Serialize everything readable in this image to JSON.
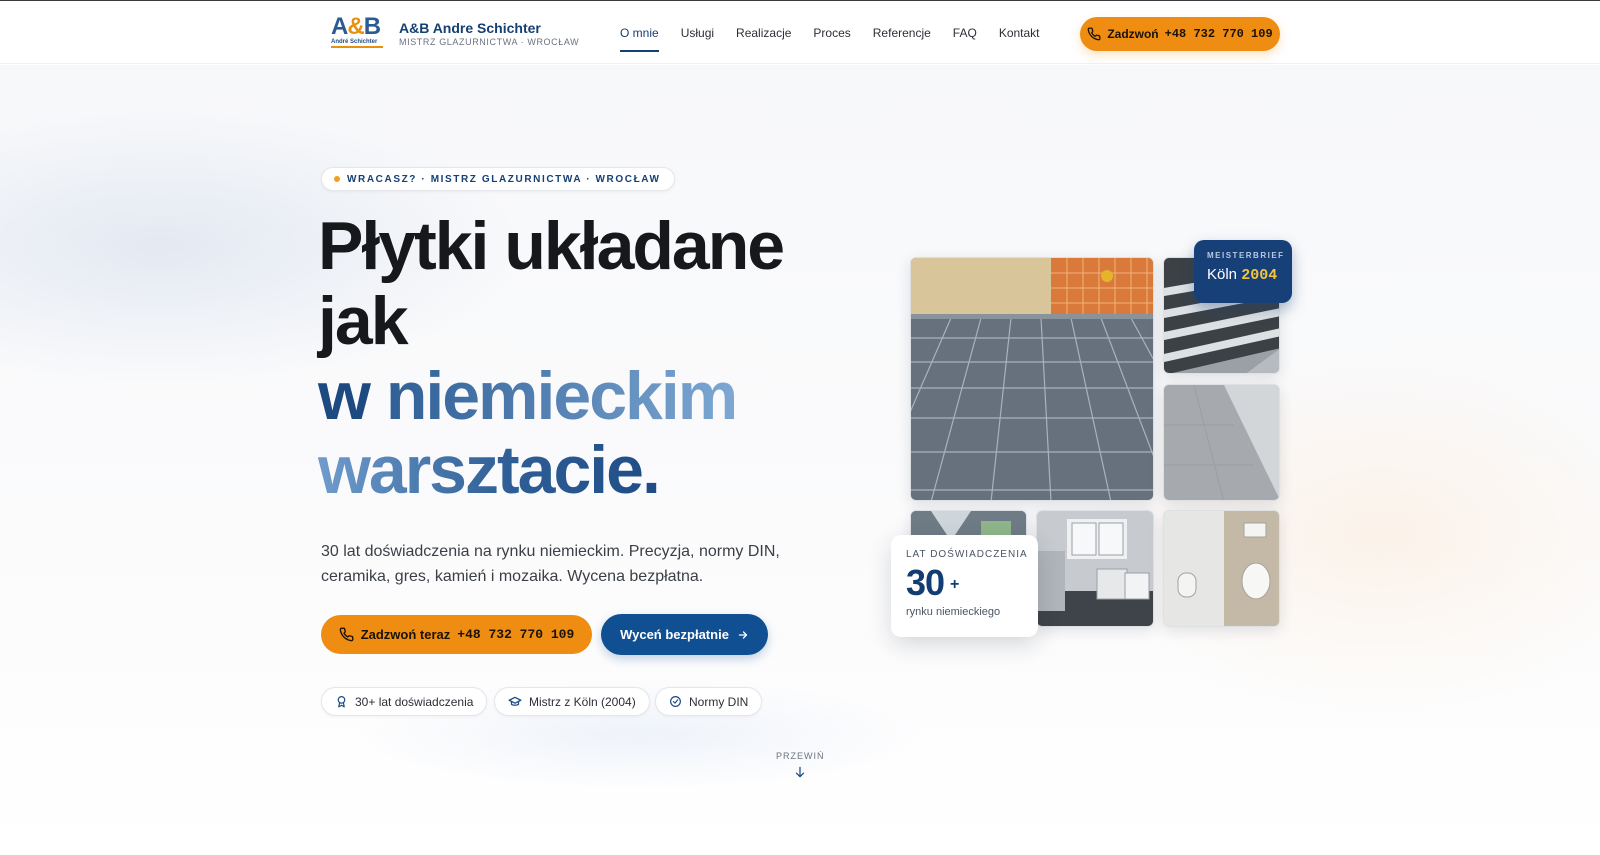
{
  "header": {
    "logo": {
      "letters_a": "A",
      "letters_amp": "&",
      "letters_b": "B",
      "sub": "André Schichter"
    },
    "brand_name": "A&B Andre Schichter",
    "brand_tagline": "MISTRZ GLAZURNICTWA · WROCŁAW",
    "nav": [
      {
        "label": "O mnie",
        "active": true
      },
      {
        "label": "Usługi",
        "active": false
      },
      {
        "label": "Realizacje",
        "active": false
      },
      {
        "label": "Proces",
        "active": false
      },
      {
        "label": "Referencje",
        "active": false
      },
      {
        "label": "FAQ",
        "active": false
      },
      {
        "label": "Kontakt",
        "active": false
      }
    ],
    "call_button": {
      "label": "Zadzwoń",
      "phone": "+48 732 770 109",
      "icon": "phone-icon"
    }
  },
  "hero": {
    "eyebrow": "WRACASZ? · MISTRZ GLAZURNICTWA · WROCŁAW",
    "headline": {
      "line1": "Płytki układane",
      "line2": "jak",
      "line3_a": "w",
      "line3_b": "niemieckim",
      "line4": "warsztacie."
    },
    "lead": "30 lat doświadczenia na rynku niemieckim. Precyzja, normy DIN, ceramika, gres, kamień i mozaika. Wycena bezpłatna.",
    "cta_call": {
      "label": "Zadzwoń teraz",
      "phone": "+48 732 770 109",
      "icon": "phone-icon"
    },
    "cta_quote": {
      "label": "Wyceń bezpłatnie",
      "icon": "arrow-right-icon"
    },
    "chips": [
      {
        "label": "30+ lat doświadczenia",
        "icon": "award-icon"
      },
      {
        "label": "Mistrz z Köln (2004)",
        "icon": "graduation-cap-icon"
      },
      {
        "label": "Normy DIN",
        "icon": "check-circle-icon"
      }
    ],
    "scroll_hint": "PRZEWIŃ"
  },
  "gallery": {
    "meister_badge": {
      "label": "MEISTERBRIEF",
      "city": "Köln",
      "year": "2004"
    },
    "experience_card": {
      "label": "LAT DOŚWIADCZENIA",
      "value": "30",
      "suffix": "+",
      "sub": "rynku niemieckiego"
    }
  },
  "colors": {
    "accent_orange": "#ee8d11",
    "brand_navy": "#173f78",
    "button_blue": "#0f4f92",
    "year_gold": "#f3c53c"
  }
}
